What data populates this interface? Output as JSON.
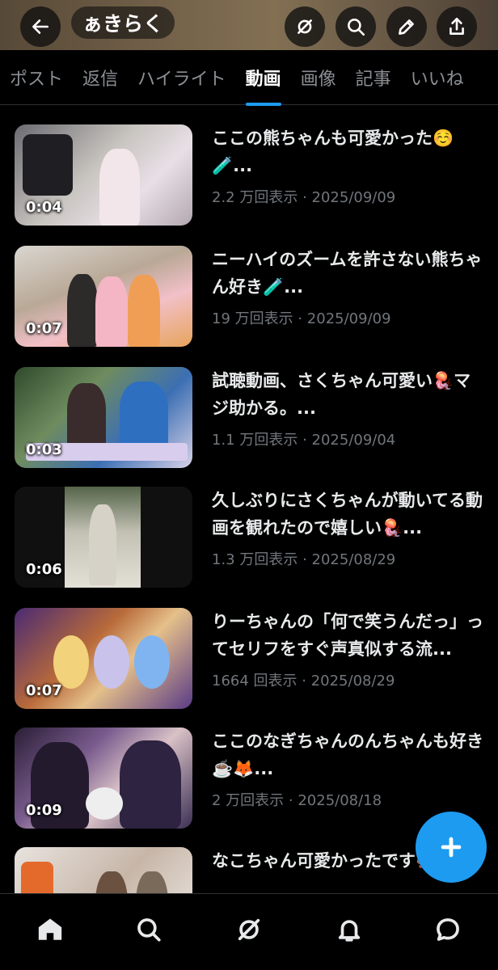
{
  "header": {
    "title": "ぁきらく"
  },
  "tabs": [
    {
      "label": "ポスト"
    },
    {
      "label": "返信"
    },
    {
      "label": "ハイライト"
    },
    {
      "label": "動画",
      "active": true
    },
    {
      "label": "画像"
    },
    {
      "label": "記事"
    },
    {
      "label": "いいね"
    }
  ],
  "videos": [
    {
      "duration": "0:04",
      "title": "ここの熊ちゃんも可愛かった☺️🧪...",
      "meta": "2.2 万回表示 · 2025/09/09"
    },
    {
      "duration": "0:07",
      "title": "ニーハイのズームを許さない熊ちゃん好き🧪...",
      "meta": "19 万回表示 · 2025/09/09"
    },
    {
      "duration": "0:03",
      "title": "試聴動画、さくちゃん可愛い🪼マジ助かる。...",
      "meta": "1.1 万回表示 · 2025/09/04"
    },
    {
      "duration": "0:06",
      "title": "久しぶりにさくちゃんが動いてる動画を観れたので嬉しい🪼...",
      "meta": "1.3 万回表示 · 2025/08/29"
    },
    {
      "duration": "0:07",
      "title": "りーちゃんの「何で笑うんだっ」ってセリフをすぐ声真似する流...",
      "meta": "1664 回表示 · 2025/08/29"
    },
    {
      "duration": "0:09",
      "title": "ここのなぎちゃんのんちゃんも好き☕️🦊...",
      "meta": "2 万回表示 · 2025/08/18"
    },
    {
      "duration": "",
      "title": "なこちゃん可愛かったです🐙...",
      "meta": ""
    }
  ],
  "colors": {
    "accent": "#1d9bf0",
    "background": "#000000",
    "muted": "#71767b"
  },
  "icons": {
    "back": "arrow-left-icon",
    "grok": "grok-icon",
    "search": "search-icon",
    "edit": "pencil-icon",
    "share": "share-icon",
    "compose": "plus-icon",
    "nav": [
      "home-icon",
      "search-icon",
      "grok-icon",
      "bell-icon",
      "chat-bubble-icon"
    ]
  }
}
